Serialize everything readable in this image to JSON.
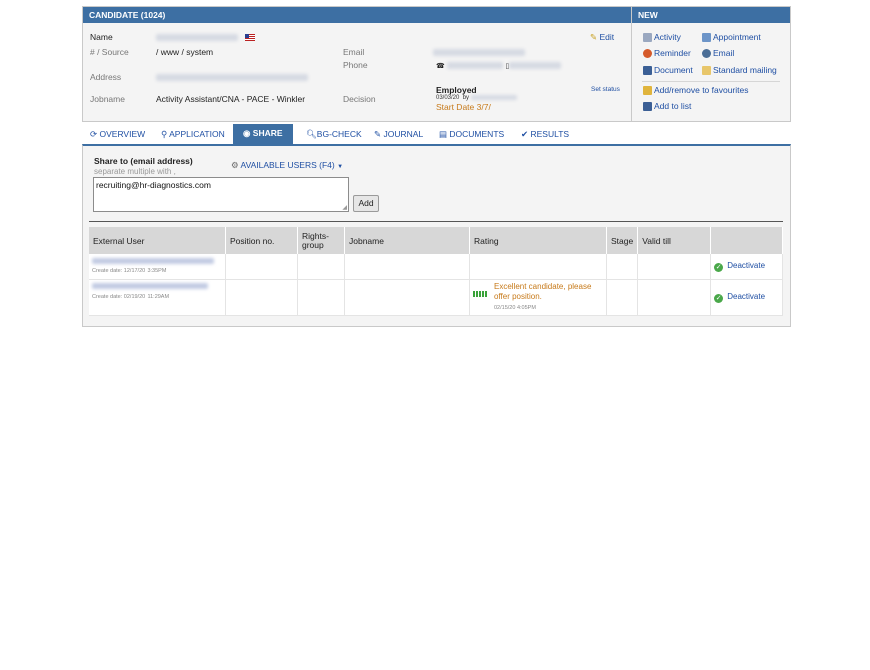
{
  "candidate": {
    "header": "CANDIDATE (1024)",
    "name_label": "Name",
    "source_label": "# / Source",
    "source_value": "/ www / system",
    "address_label": "Address",
    "jobname_label": "Jobname",
    "jobname_value": "Activity Assistant/CNA - PACE - Winkler",
    "email_label": "Email",
    "phone_label": "Phone",
    "decision_label": "Decision",
    "edit_label": "Edit",
    "set_status_label": "Set status",
    "status_title": "Employed",
    "status_date": "03/03/20",
    "status_by": "by",
    "start_date": "Start Date 3/7/"
  },
  "new_panel": {
    "header": "NEW",
    "items": {
      "activity": "Activity",
      "appointment": "Appointment",
      "reminder": "Reminder",
      "email": "Email",
      "document": "Document",
      "standard_mailing": "Standard mailing",
      "favourites": "Add/remove to favourites",
      "add_to_list": "Add to list"
    }
  },
  "tabs": {
    "overview": "OVERVIEW",
    "application": "APPLICATION",
    "share": "SHARE",
    "bgcheck": "BG-CHECK",
    "journal": "JOURNAL",
    "documents": "DOCUMENTS",
    "results": "RESULTS"
  },
  "share": {
    "title": "Share to (email address)",
    "hint": "separate multiple with ,",
    "available_users": "AVAILABLE USERS (F4)",
    "email_value": "recruiting@hr-diagnostics.com",
    "add_button": "Add"
  },
  "table": {
    "headers": {
      "external_user": "External User",
      "position_no": "Position no.",
      "rights_group_1": "Rights-",
      "rights_group_2": "group",
      "jobname": "Jobname",
      "rating": "Rating",
      "stage": "Stage",
      "valid_till": "Valid till"
    },
    "rows": [
      {
        "create_date": "Create date: 12/17/20",
        "create_time": "3:35PM",
        "action": "Deactivate"
      },
      {
        "create_date": "Create date: 02/19/20",
        "create_time": "11:29AM",
        "rating_text_1": "Excellent candidate, please",
        "rating_text_2": "offer position.",
        "rating_date": "02/15/20",
        "rating_time": "4:05PM",
        "rating_level": 5,
        "action": "Deactivate"
      }
    ]
  },
  "colors": {
    "header_blue": "#3d6fa3",
    "link_blue": "#1f4fa3",
    "rating_orange": "#c77a1a",
    "rating_green": "#3aa33a"
  }
}
